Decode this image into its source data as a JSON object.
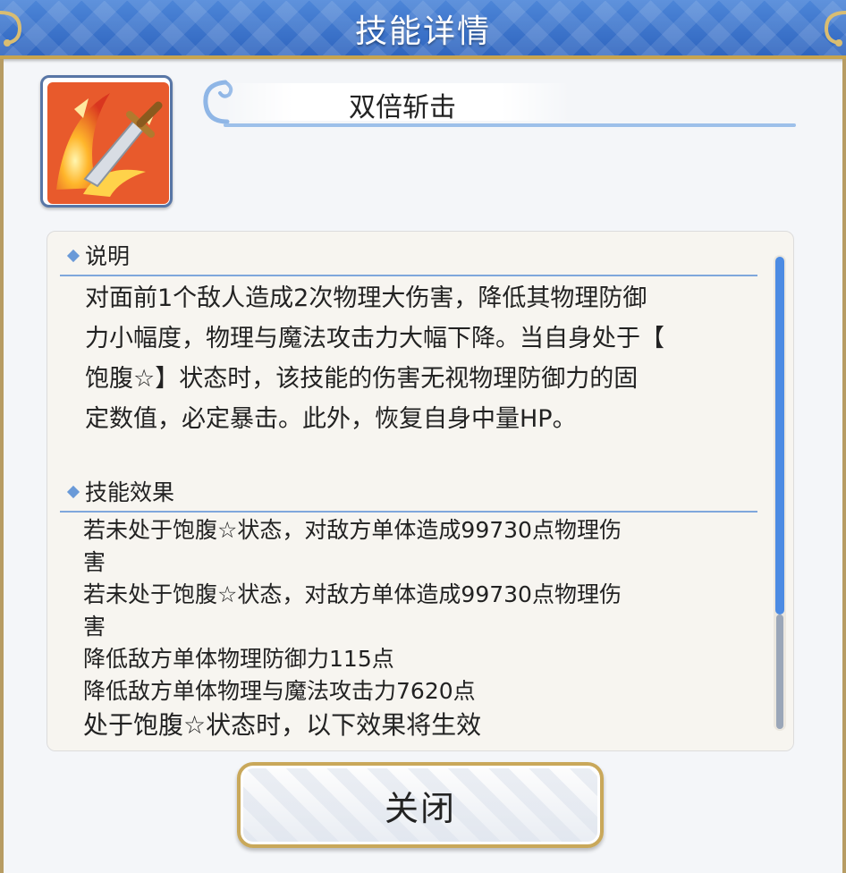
{
  "header": {
    "title": "技能详情"
  },
  "skill": {
    "icon": "sword-slash-icon",
    "name": "双倍斩击"
  },
  "description": {
    "heading": "说明",
    "lines": [
      "对面前1个敌人造成2次物理大伤害，降低其物理防御",
      "力小幅度，物理与魔法攻击力大幅下降。当自身处于【",
      "饱腹☆】状态时，该技能的伤害无视物理防御力的固",
      "定数值，必定暴击。此外，恢复自身中量HP。"
    ]
  },
  "effects": {
    "heading": "技能效果",
    "lines": [
      "若未处于饱腹☆状态，对敌方单体造成99730点物理伤",
      "害",
      "若未处于饱腹☆状态，对敌方单体造成99730点物理伤",
      "害",
      "降低敌方单体物理防御力115点",
      "降低敌方单体物理与魔法攻击力7620点",
      "处于饱腹☆状态时，以下效果将生效"
    ]
  },
  "scrollbar": {
    "position_fraction": 0.75
  },
  "footer": {
    "close_label": "关闭"
  },
  "colors": {
    "header_blue": "#3a72cc",
    "accent_gold": "#c9a85a",
    "scroll_blue": "#4c8be3"
  }
}
